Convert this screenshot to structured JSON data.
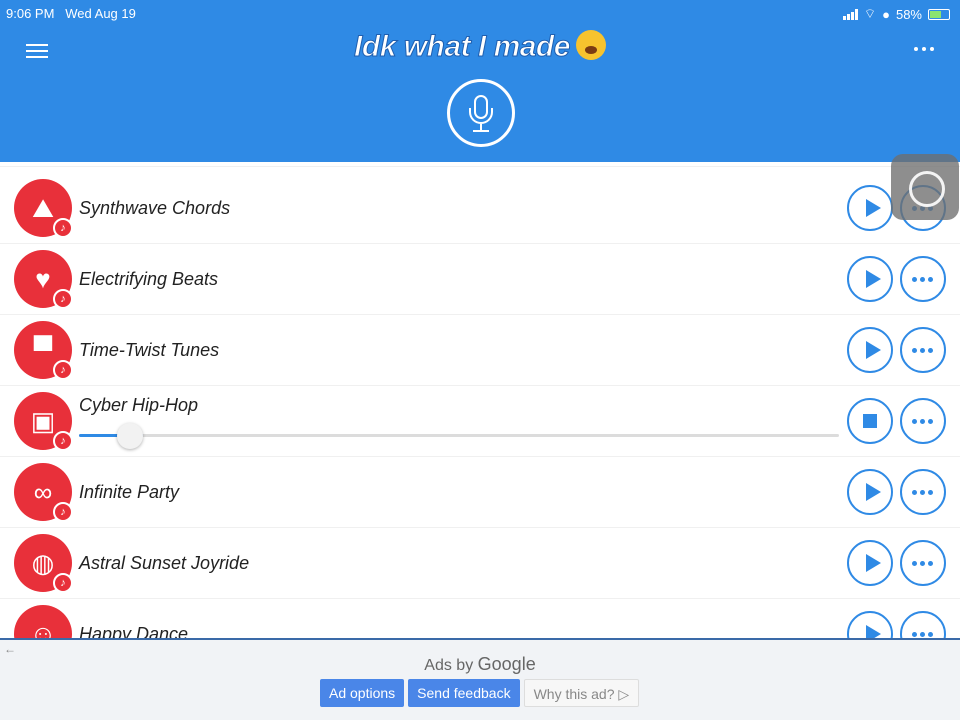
{
  "status_bar": {
    "time": "9:06 PM",
    "date": "Wed Aug 19",
    "battery": "58%"
  },
  "header": {
    "title": "Idk what I made",
    "menu_icon": "hamburger-icon",
    "more_icon": "more-icon",
    "mic_icon": "microphone-icon"
  },
  "songs": [
    {
      "name": "Synthwave Chords",
      "icon": "sun-mountains-icon",
      "state": "play"
    },
    {
      "name": "Electrifying Beats",
      "icon": "lightning-heart-icon",
      "state": "play"
    },
    {
      "name": "Time-Twist Tunes",
      "icon": "top-hat-icon",
      "state": "play"
    },
    {
      "name": "Cyber Hip-Hop",
      "icon": "boombox-icon",
      "state": "playing",
      "progress": 0.05
    },
    {
      "name": "Infinite Party",
      "icon": "infinity-icon",
      "state": "play"
    },
    {
      "name": "Astral Sunset Joyride",
      "icon": "planet-icon",
      "state": "play"
    },
    {
      "name": "Happy Dance",
      "icon": "smiley-icon",
      "state": "play"
    }
  ],
  "ad": {
    "ads_by": "Ads by",
    "brand": "Google",
    "options": "Ad options",
    "feedback": "Send feedback",
    "why": "Why this ad? ▷"
  },
  "colors": {
    "primary": "#2f8ae5",
    "avatar": "#e8303a"
  }
}
